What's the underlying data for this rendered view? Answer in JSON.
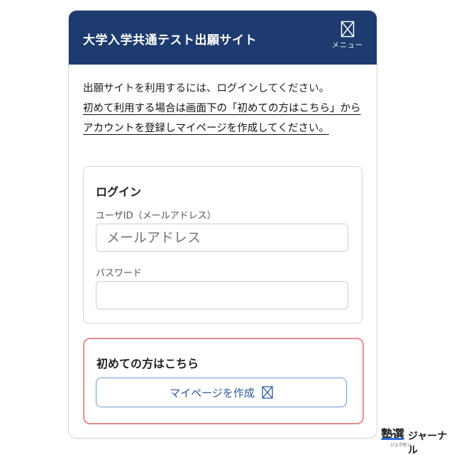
{
  "header": {
    "title": "大学入学共通テスト出願サイト",
    "menu_label": "メニュー",
    "menu_icon": "broken-image-icon"
  },
  "intro": {
    "line1": "出願サイトを利用するには、ログインしてください。",
    "link_text": "初めて利用する場合は画面下の「初めての方はこちら」からアカウントを登録しマイページを作成してください。"
  },
  "login": {
    "title": "ログイン",
    "user_label": "ユーザID（メールアドレス）",
    "user_placeholder": "メールアドレス",
    "password_label": "パスワード",
    "password_value": ""
  },
  "register": {
    "title": "初めての方はこちら",
    "button_label": "マイページを作成",
    "button_icon": "broken-image-icon",
    "border_color": "#e88c8c"
  },
  "logo": {
    "mark": "塾選",
    "sub": "ジュクセン",
    "name": "ジャーナル"
  },
  "colors": {
    "header_bg": "#1d3b6e",
    "button_text": "#2a5aa0"
  }
}
